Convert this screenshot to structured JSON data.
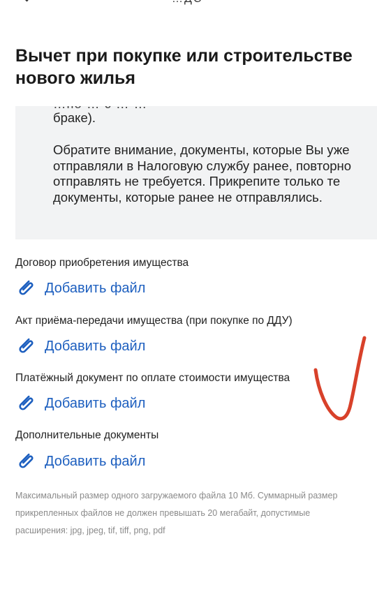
{
  "header": {
    "title_fragment": "…ДС"
  },
  "page": {
    "title": "Вычет при покупке или строительстве нового жилья"
  },
  "info": {
    "cut_line": "…по … с … …",
    "line_end": "браке).",
    "notice": "Обратите внимание, документы, которые Вы уже отправляли в Налоговую службу ранее, повторно отправлять не требуется. Прикрепите только те документы, которые ранее не отправлялись."
  },
  "documents": [
    {
      "label": "Договор приобретения имущества",
      "action": "Добавить файл"
    },
    {
      "label": "Акт приёма-передачи имущества (при покупке по ДДУ)",
      "action": "Добавить файл"
    },
    {
      "label": "Платёжный документ по оплате стоимости имущества",
      "action": "Добавить файл"
    },
    {
      "label": "Дополнительные документы",
      "action": "Добавить файл"
    }
  ],
  "footnote": "Максимальный размер одного загружаемого файла 10 Мб. Суммарный размер прикрепленных файлов не должен превышать 20 мегабайт, допустимые расширения: jpg, jpeg, tif, tiff, png, pdf",
  "colors": {
    "link": "#1d5fbf",
    "info_background": "#f2f3f4",
    "annotation": "#d8412a"
  },
  "icons": {
    "back": "chevron-left-icon",
    "attach": "paperclip-icon",
    "annotation": "checkmark-icon"
  }
}
